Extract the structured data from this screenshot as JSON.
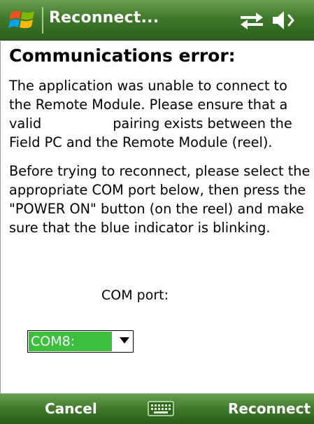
{
  "title_bar": {
    "title": "Reconnect...",
    "icons": [
      "windows-start-icon",
      "connectivity-arrows-icon",
      "speaker-muted-icon"
    ]
  },
  "dialog": {
    "heading": "Communications error:",
    "paragraph1_lines": [
      "The application was unable to connect to",
      "the Remote Module. Please ensure that a",
      "valid",
      "pairing exists between the",
      "Field PC and the Remote Module (reel)."
    ],
    "paragraph2_lines": [
      "Before trying to reconnect, please select the",
      "appropriate COM port below, then press the",
      "\"POWER ON\" button (on the reel) and make",
      "sure that the blue indicator is blinking."
    ]
  },
  "com_port": {
    "label": "COM port:",
    "selected": "COM8:"
  },
  "soft_keys": {
    "left": "Cancel",
    "right": "Reconnect",
    "center_icon": "keyboard-icon"
  },
  "colors": {
    "title_bar_green": "#3f7a2a",
    "selection_green": "#3cbf3c",
    "text": "#000000",
    "background": "#ffffff"
  }
}
